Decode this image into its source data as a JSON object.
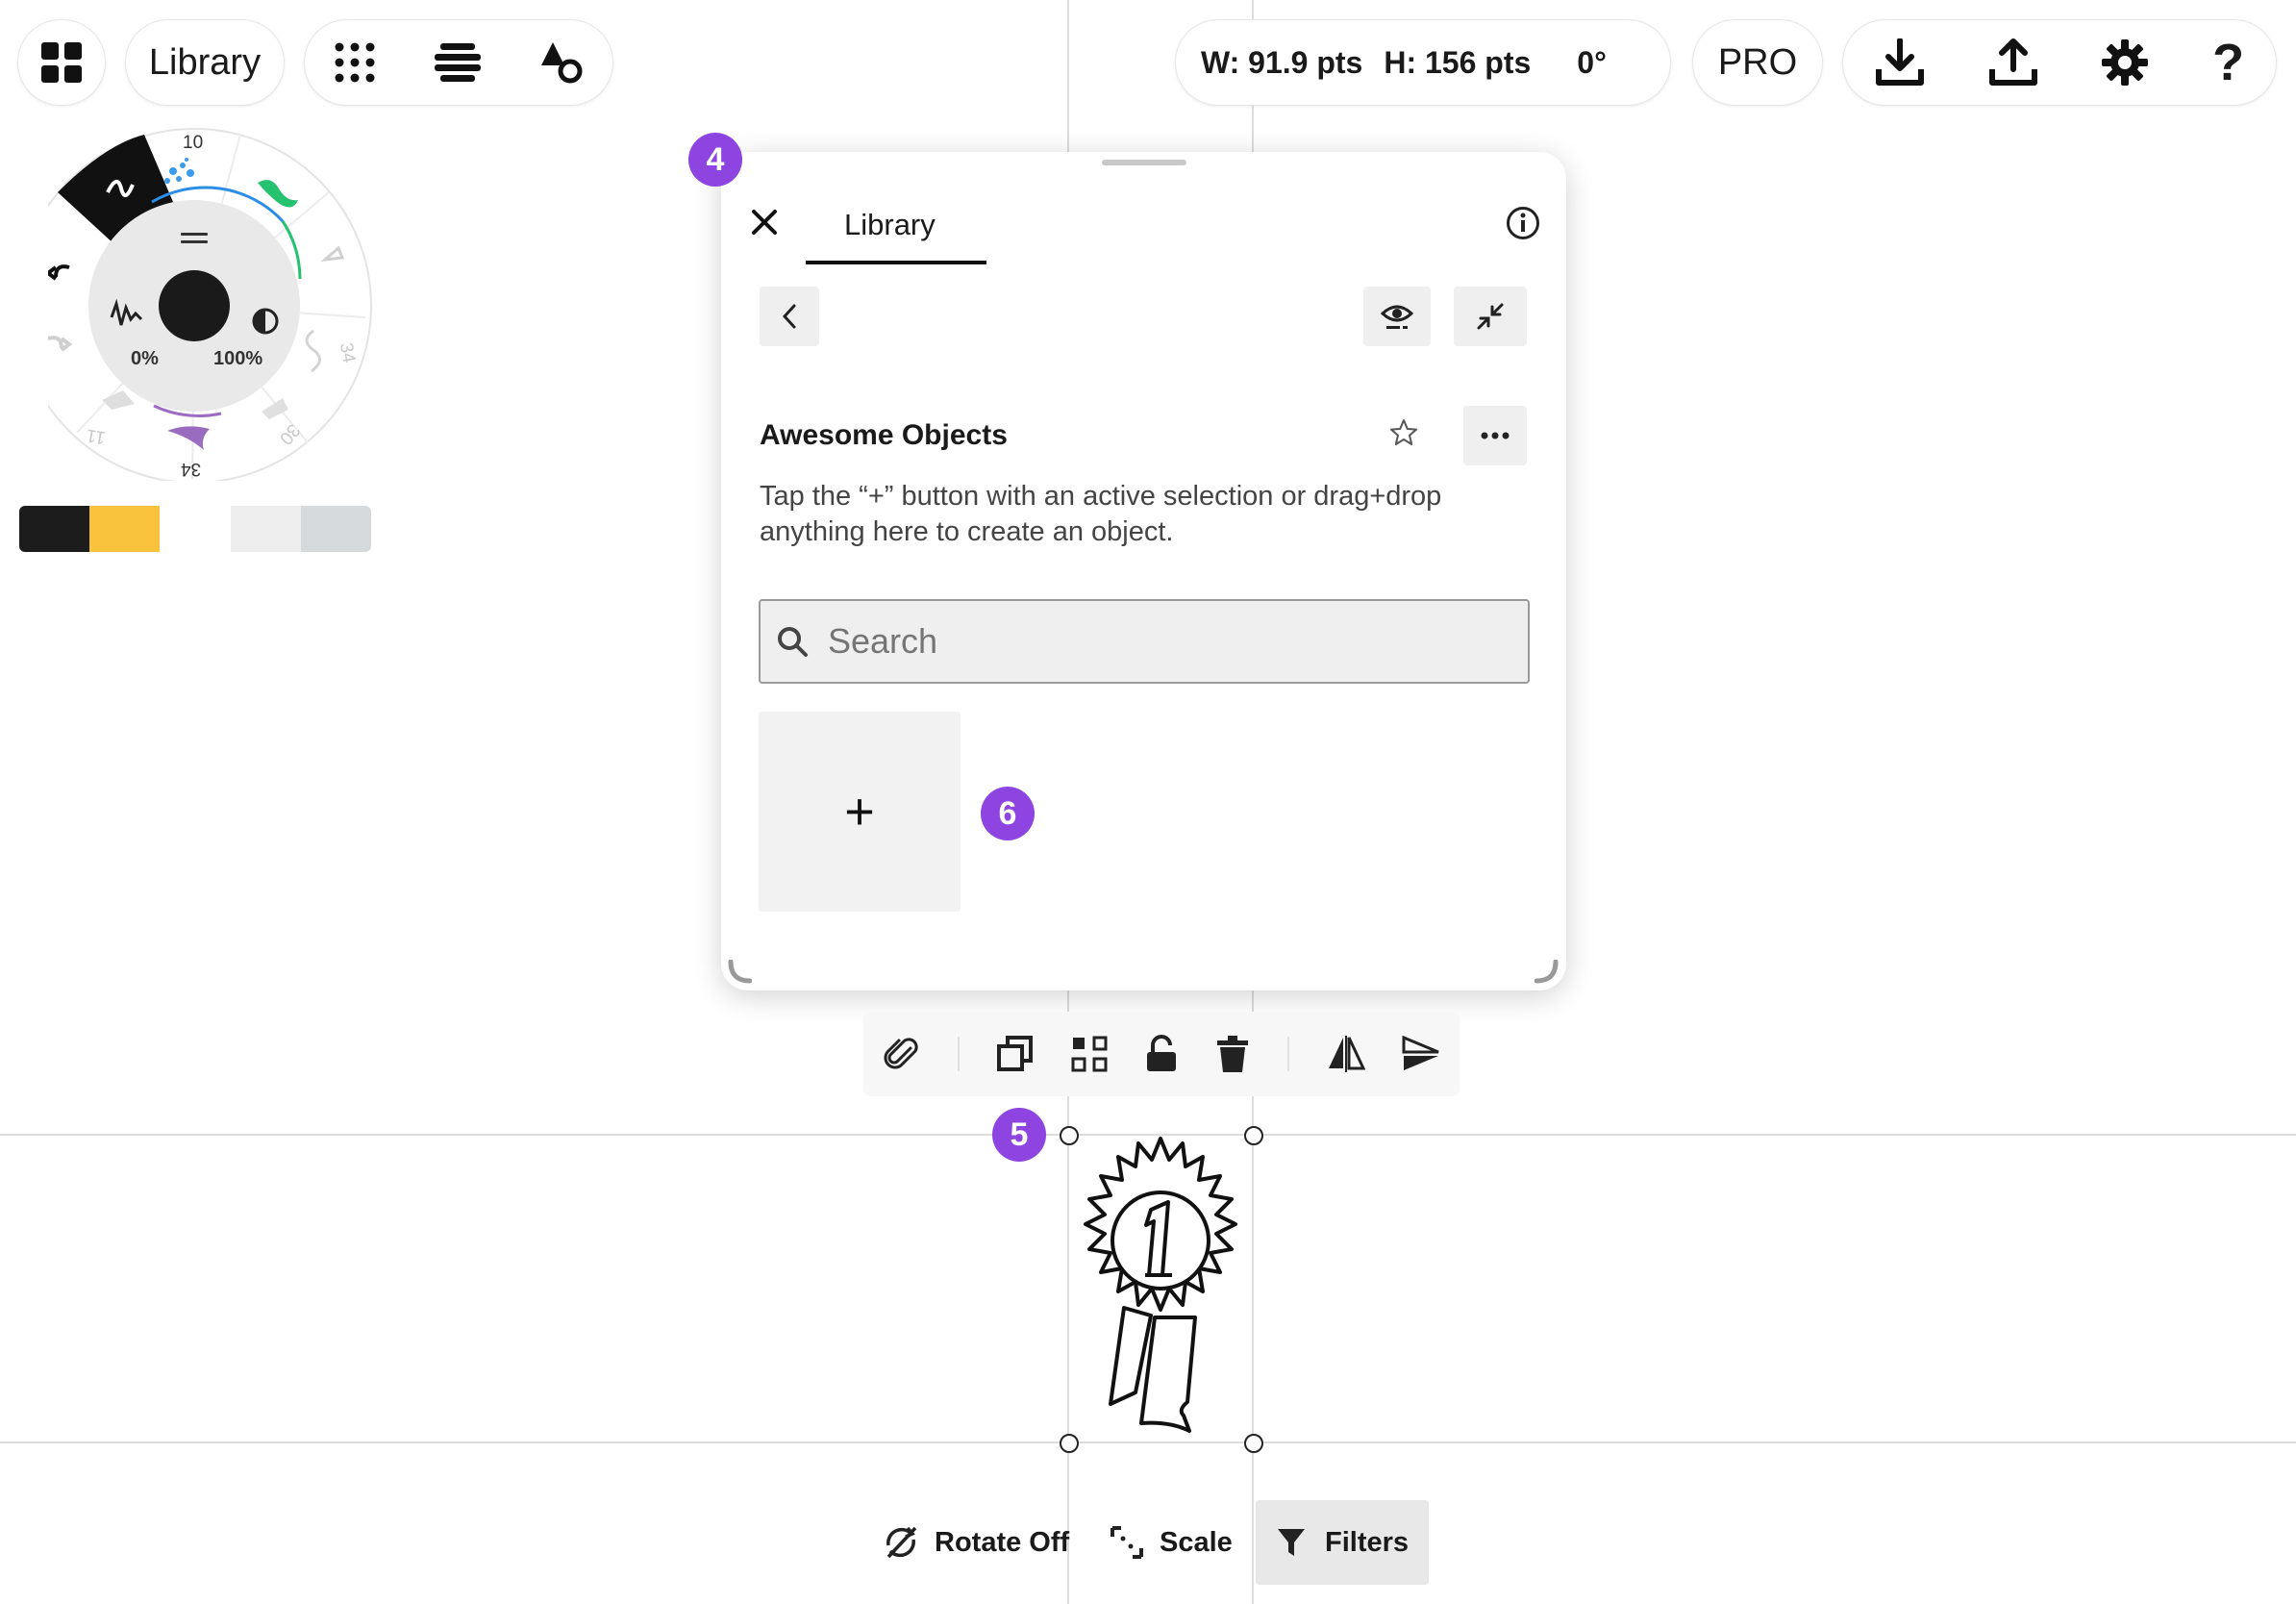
{
  "topbar": {
    "library_label": "Library",
    "dimensions": {
      "width": "W: 91.9 pts",
      "height": "H: 156 pts",
      "rotation": "0°"
    },
    "pro_label": "PRO",
    "help_label": "?"
  },
  "brush_wheel": {
    "size_top": "10",
    "opacity_left": "0%",
    "opacity_right": "100%",
    "size_bottom": "34",
    "size_right": "34",
    "size_lower_right": "30",
    "size_lower_left": "11",
    "main_color": "#1a1a1a"
  },
  "swatches": [
    "#1c1c1c",
    "#f9c23c",
    "#ffffff",
    "#eeeeee",
    "#d6dadc"
  ],
  "library_panel": {
    "tab_label": "Library",
    "collection_title": "Awesome Objects",
    "description": "Tap the “+” button with an active selection or drag+drop anything here to create an object.",
    "search_placeholder": "Search",
    "add_label": "+"
  },
  "badges": {
    "four": "4",
    "five": "5",
    "six": "6"
  },
  "bottom_bar": {
    "rotate_label": "Rotate Off",
    "scale_label": "Scale",
    "filters_label": "Filters"
  },
  "colors": {
    "accent_badge": "#8e44e0",
    "selected_button_bg": "#e8e8e8"
  }
}
